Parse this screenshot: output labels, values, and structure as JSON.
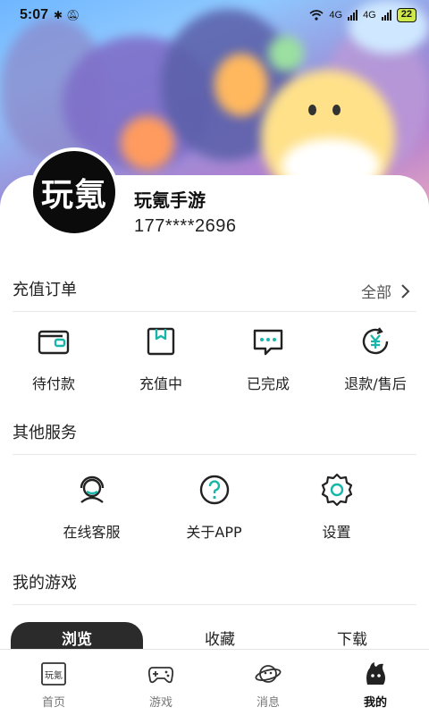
{
  "status_bar": {
    "time": "5:07",
    "left_icons": [
      "bluetooth-icon",
      "mute-icon"
    ],
    "network_1": "4G",
    "network_2": "4G",
    "battery": "22"
  },
  "profile": {
    "avatar_text": "玩氪",
    "name": "玩氪手游",
    "phone": "177****2696"
  },
  "orders": {
    "title": "充值订单",
    "view_all": "全部",
    "items": [
      {
        "label": "待付款",
        "icon": "wallet-icon"
      },
      {
        "label": "充值中",
        "icon": "package-icon"
      },
      {
        "label": "已完成",
        "icon": "chat-dots-icon"
      },
      {
        "label": "退款/售后",
        "icon": "yen-refund-icon"
      }
    ]
  },
  "services": {
    "title": "其他服务",
    "items": [
      {
        "label": "在线客服",
        "icon": "headset-icon"
      },
      {
        "label": "关于APP",
        "icon": "question-icon"
      },
      {
        "label": "设置",
        "icon": "gear-icon"
      }
    ]
  },
  "games": {
    "title": "我的游戏",
    "tabs": [
      {
        "label": "浏览",
        "active": true
      },
      {
        "label": "收藏",
        "active": false
      },
      {
        "label": "下载",
        "active": false
      }
    ]
  },
  "bottom_nav": [
    {
      "label": "首页",
      "icon": "home-logo-icon",
      "active": false
    },
    {
      "label": "游戏",
      "icon": "gamepad-icon",
      "active": false
    },
    {
      "label": "消息",
      "icon": "planet-icon",
      "active": false
    },
    {
      "label": "我的",
      "icon": "mine-character-icon",
      "active": true
    }
  ],
  "colors": {
    "accent": "#18b6a8",
    "dark": "#2b2b2b",
    "battery": "#cfe84a"
  }
}
